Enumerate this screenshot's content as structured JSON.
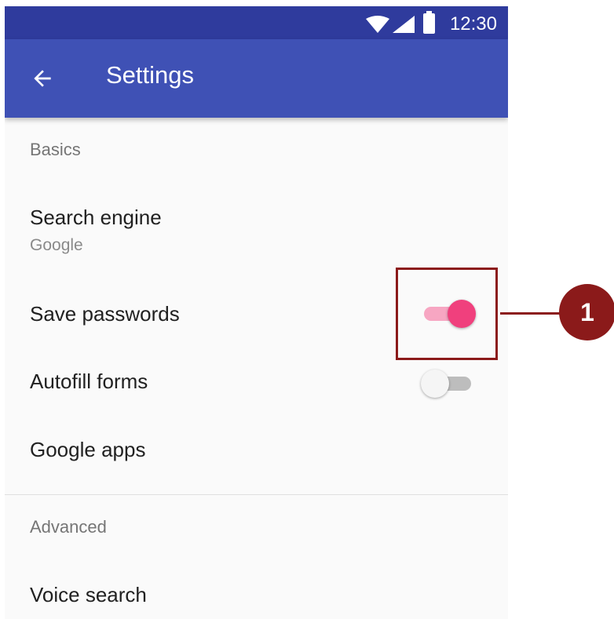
{
  "status_bar": {
    "time": "12:30"
  },
  "app_bar": {
    "title": "Settings"
  },
  "sections": [
    {
      "header": "Basics",
      "items": [
        {
          "title": "Search engine",
          "subtitle": "Google"
        },
        {
          "title": "Save passwords",
          "switch_on": true
        },
        {
          "title": "Autofill forms",
          "switch_on": false
        },
        {
          "title": "Google apps"
        }
      ]
    },
    {
      "header": "Advanced",
      "items": [
        {
          "title": "Voice search"
        }
      ]
    }
  ],
  "annotation": {
    "callout_number": "1"
  },
  "colors": {
    "status_bar": "#2f3b9d",
    "app_bar": "#3f51b5",
    "switch_accent": "#f0407d",
    "callout": "#8b1a1a"
  }
}
